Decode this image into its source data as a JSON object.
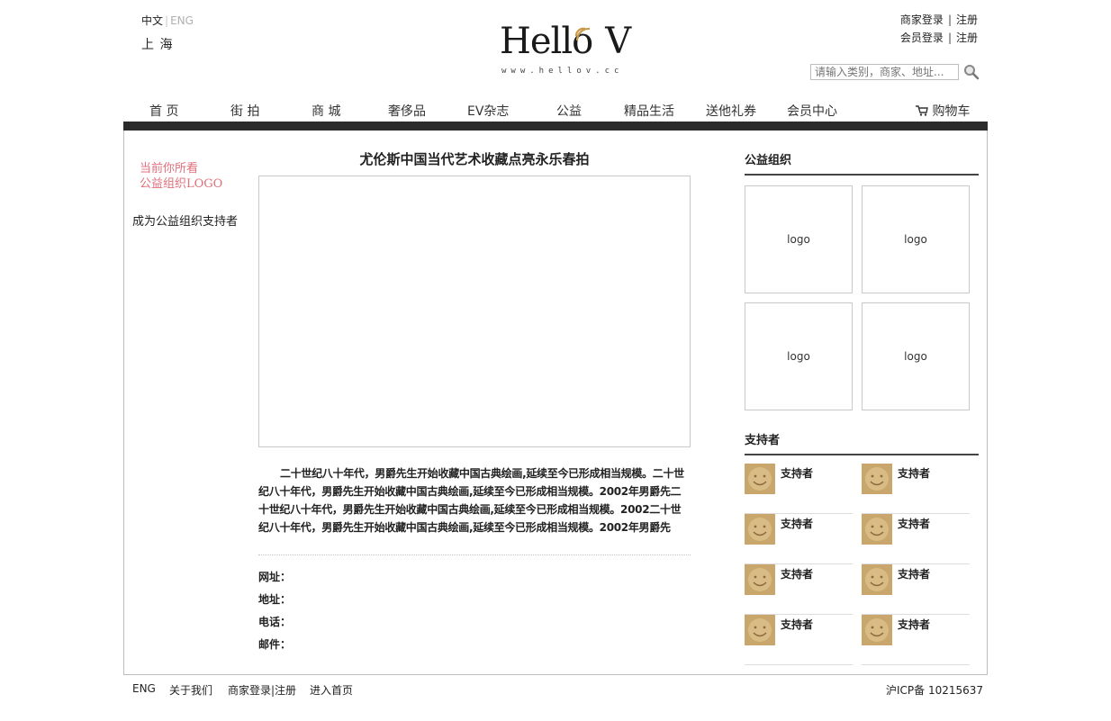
{
  "header": {
    "lang_zh": "中文",
    "lang_sep": "|",
    "lang_en": "ENG",
    "city": "上 海",
    "logo_text_left": "Hello",
    "logo_text_right": "V",
    "logo_url": "www.hellov.cc",
    "merchant_login": "商家登录",
    "merchant_register": "注册",
    "member_login": "会员登录",
    "member_register": "注册",
    "search_placeholder": "请输入类别，商家、地址..."
  },
  "nav": {
    "items": [
      "首 页",
      "街 拍",
      "商 城",
      "奢侈品",
      "EV杂志",
      "公益",
      "精品生活",
      "送他礼券",
      "会员中心"
    ],
    "cart": "购物车"
  },
  "left": {
    "notice_line1": "当前你所看",
    "notice_line2": "公益组织LOGO",
    "become_supporter": "成为公益组织支持者"
  },
  "article": {
    "title": "尤伦斯中国当代艺术收藏点亮永乐春拍",
    "body": "二十世纪八十年代，男爵先生开始收藏中国古典绘画,延续至今已形成相当规模。二十世纪八十年代，男爵先生开始收藏中国古典绘画,延续至今已形成相当规模。2002年男爵先二十世纪八十年代，男爵先生开始收藏中国古典绘画,延续至今已形成相当规模。2002二十世纪八十年代，男爵先生开始收藏中国古典绘画,延续至今已形成相当规模。2002年男爵先",
    "website_label": "网址：",
    "address_label": "地址：",
    "phone_label": "电话：",
    "email_label": "邮件："
  },
  "sidebar": {
    "org_title": "公益组织",
    "logos": [
      "logo",
      "logo",
      "logo",
      "logo"
    ],
    "supporters_title": "支持者",
    "supporters": [
      "支持者",
      "支持者",
      "支持者",
      "支持者",
      "支持者",
      "支持者",
      "支持者",
      "支持者"
    ]
  },
  "footer": {
    "eng": "ENG",
    "about": "关于我们",
    "merchant_login": "商家登录|注册",
    "enter_home": "进入首页",
    "icp": "沪ICP备 10215637"
  },
  "colors": {
    "nav_bar": "#2b2b2b",
    "notice": "#e0707c",
    "logo_accent": "#c99a4a",
    "avatar": "#c9a66b"
  }
}
